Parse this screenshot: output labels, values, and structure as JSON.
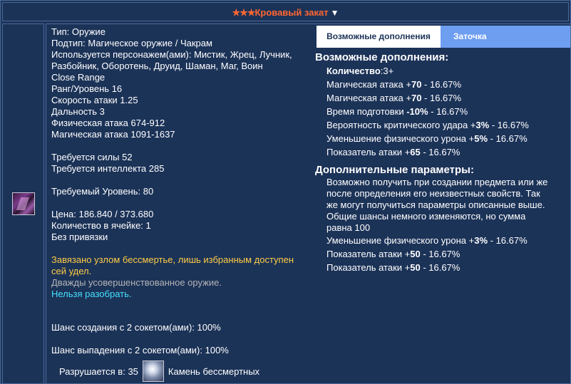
{
  "title": {
    "stars": "★★★",
    "name": "Кровавый закат",
    "arrow": "▼"
  },
  "icons": {
    "item": "weapon-chakram-icon",
    "gem": "immortal-stone-icon"
  },
  "colors": {
    "title": "#ff6633",
    "gold": "#ffcc44",
    "gray": "#b4b4b4",
    "cyan": "#44e0ff",
    "tab_active": "#6e9ef0"
  },
  "item": {
    "type": "Тип: Оружие",
    "subtype": "Подтип: Магическое оружие / Чакрам",
    "used_by_1": "Используется персонажем(ами): Мистик, Жрец, Лучник,",
    "used_by_2": "Разбойник, Оборотень, Друид, Шаман, Маг, Воин",
    "range_type": "Close Range",
    "rank": "Ранг/Уровень 16",
    "attack_speed": "Скорость атаки 1.25",
    "distance": "Дальность 3",
    "phys_attack": "Физическая атака 674-912",
    "mag_attack": "Магическая атака 1091-1637",
    "req_str": "Требуется силы 52",
    "req_int": "Требуется интеллекта 285",
    "req_level": "Требуемый Уровень: 80",
    "price": "Цена: 186.840 / 373.680",
    "stack": "Количество в ячейке: 1",
    "binding": "Без привязки",
    "desc_1": "Завязано узлом бессмертье, лишь избранным доступен",
    "desc_2": "сей удел.",
    "refined": "Дважды усовершенствованное оружие.",
    "no_disassemble": "Нельзя разобрать.",
    "craft_chance": "Шанс создания с 2 сокетом(ами): 100%",
    "drop_chance": "Шанс выпадения с 2 сокетом(ами): 100%",
    "destroy_label": "Разрушается в:",
    "destroy_count": "35",
    "destroy_item": "Камень бессмертных"
  },
  "tabs": {
    "addons": "Возможные дополнения",
    "sharpen": "Заточка"
  },
  "addons": {
    "heading": "Возможные дополнения:",
    "count_label": "Количество",
    "count_value": ":3+",
    "rows": [
      {
        "pre": "Магическая атака +",
        "bold": "70",
        "post": " - 16.67%"
      },
      {
        "pre": "Магическая атака +",
        "bold": "70",
        "post": " - 16.67%"
      },
      {
        "pre": "Время подготовки ",
        "bold": "-10%",
        "post": " - 16.67%"
      },
      {
        "pre": "Вероятность критического удара +",
        "bold": "3%",
        "post": " - 16.67%"
      },
      {
        "pre": "Уменьшение физического урона +",
        "bold": "5%",
        "post": " - 16.67%"
      },
      {
        "pre": "Показатель атаки +",
        "bold": "65",
        "post": " - 16.67%"
      }
    ]
  },
  "extra": {
    "heading": "Дополнительные параметры:",
    "note_1": "Возможно получить при создании предмета или же",
    "note_2": "после определения его неизвестных свойств. Так",
    "note_3": "же могут получиться параметры описанные выше.",
    "note_4": "Общие шансы немного изменяются, но сумма",
    "note_5": "равна 100",
    "rows": [
      {
        "pre": "Уменьшение физического урона +",
        "bold": "3%",
        "post": " - 16.67%"
      },
      {
        "pre": "Показатель атаки +",
        "bold": "50",
        "post": " - 16.67%"
      },
      {
        "pre": "Показатель атаки +",
        "bold": "50",
        "post": " - 16.67%"
      }
    ]
  }
}
